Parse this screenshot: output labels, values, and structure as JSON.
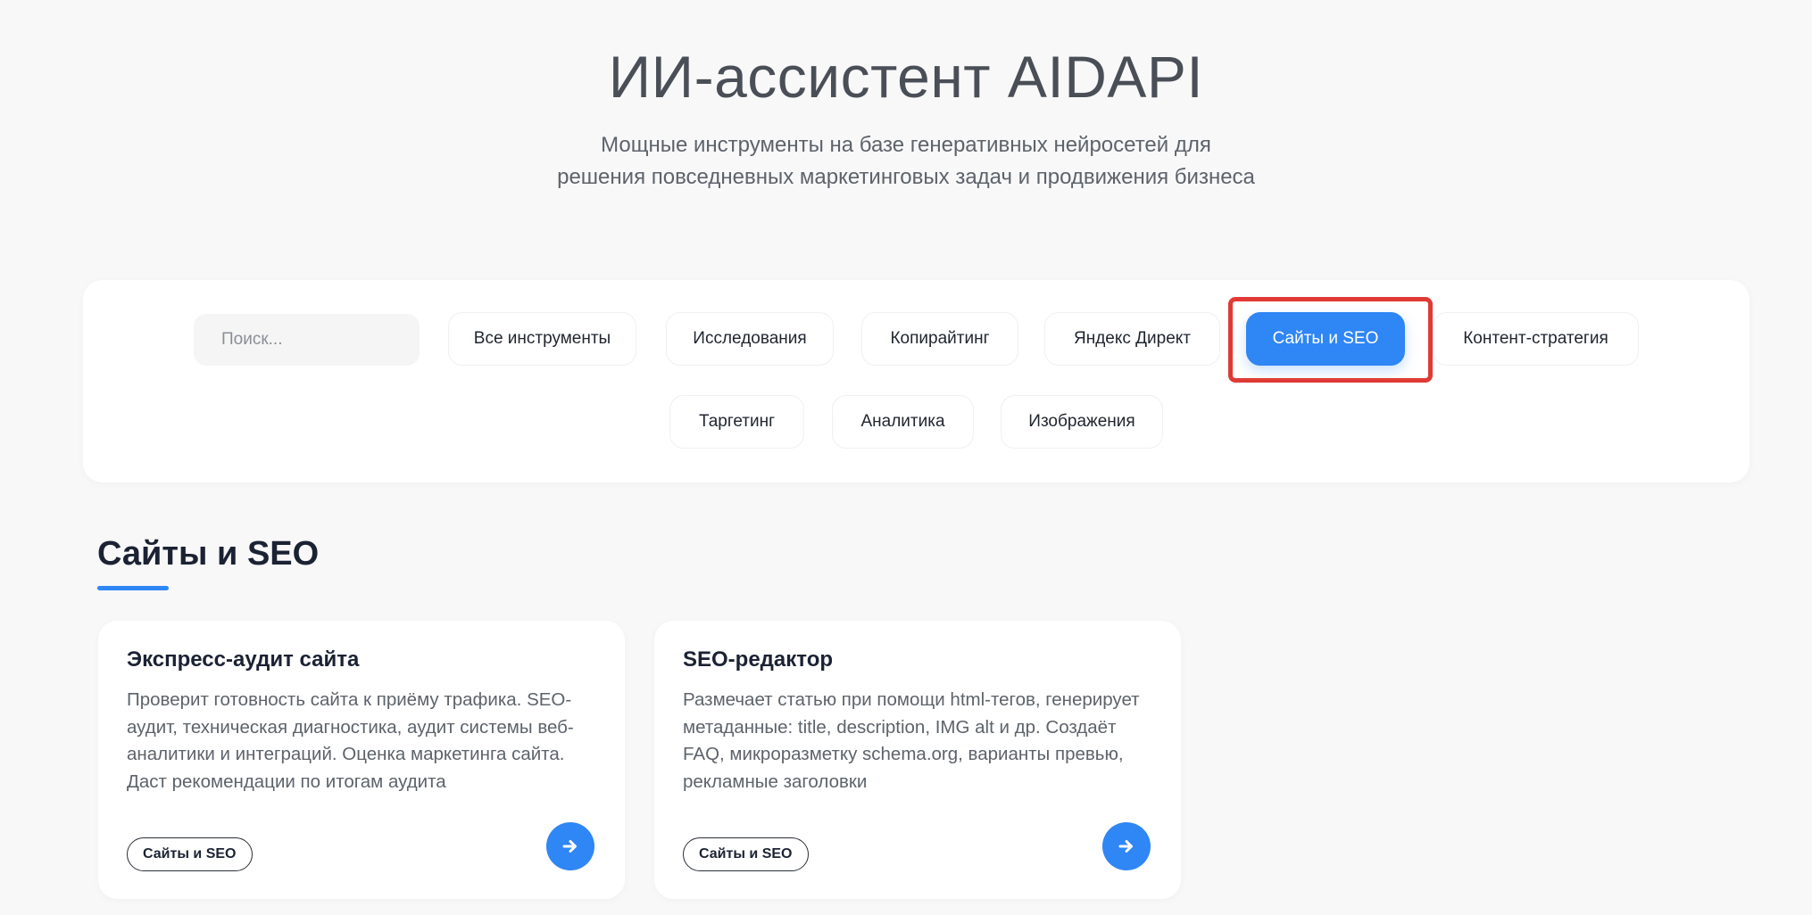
{
  "hero": {
    "title": "ИИ-ассистент AIDAPI",
    "subtitle_line1": "Мощные инструменты на базе генеративных нейросетей для",
    "subtitle_line2": "решения повседневных маркетинговых задач и продвижения бизнеса"
  },
  "filters": {
    "search_placeholder": "Поиск...",
    "selected": "Сайты и SEO",
    "items": [
      {
        "label": "Все инструменты"
      },
      {
        "label": "Исследования"
      },
      {
        "label": "Копирайтинг"
      },
      {
        "label": "Яндекс Директ"
      },
      {
        "label": "Сайты и SEO"
      },
      {
        "label": "Контент-стратегия"
      },
      {
        "label": "Таргетинг"
      },
      {
        "label": "Аналитика"
      },
      {
        "label": "Изображения"
      }
    ]
  },
  "section": {
    "title": "Сайты и SEO"
  },
  "cards": [
    {
      "title": "Экспресс-аудит сайта",
      "description": "Проверит готовность сайта к приёму трафика. SEO-аудит, техническая диагностика, аудит системы веб-аналитики и интеграций. Оценка маркетинга сайта. Даст рекомендации по итогам аудита",
      "tag": "Сайты и SEO",
      "action_icon": "arrow-right-icon"
    },
    {
      "title": "SEO-редактор",
      "description": "Размечает статью при помощи html-тегов, генерирует метаданные: title, description, IMG alt и др. Создаёт FAQ, микроразметку schema.org, варианты превью, рекламные заголовки",
      "tag": "Сайты и SEO",
      "action_icon": "arrow-right-icon"
    }
  ],
  "colors": {
    "accent": "#2f86f5",
    "highlight": "#e03a35",
    "background": "#f8f8f9"
  }
}
